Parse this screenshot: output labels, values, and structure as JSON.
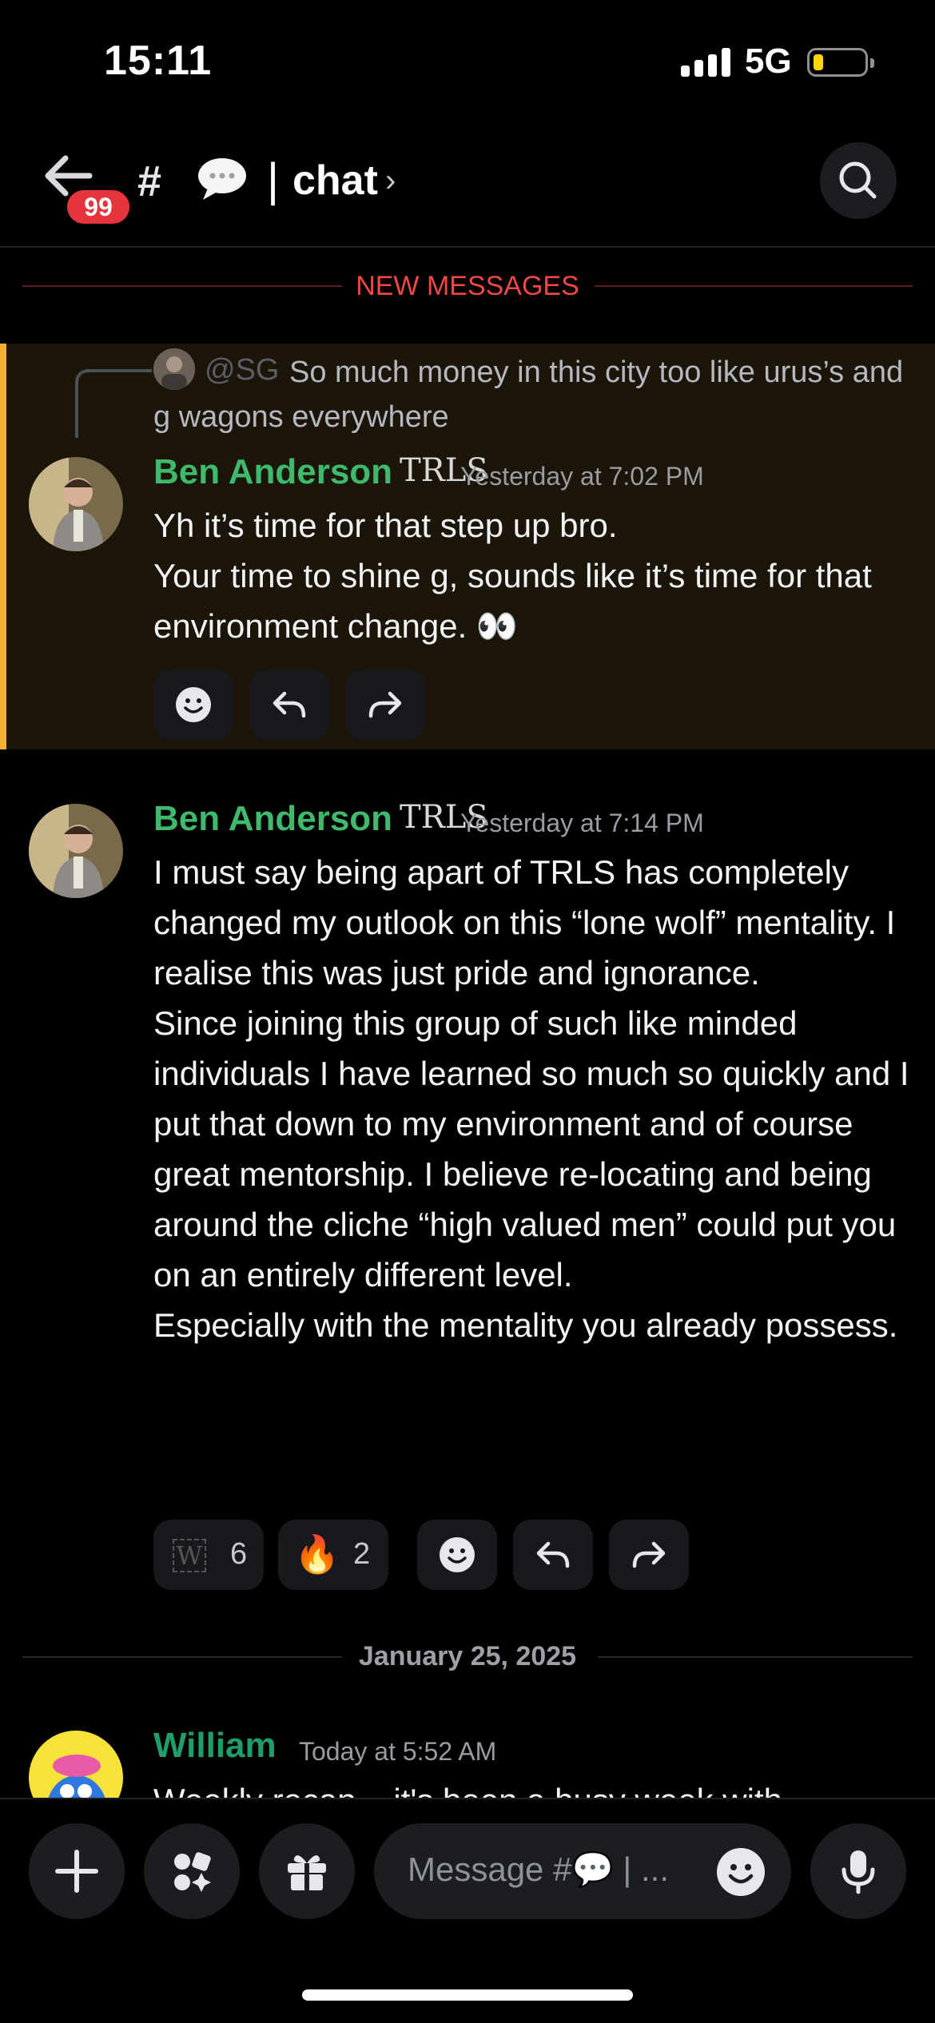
{
  "status_bar": {
    "time": "15:11",
    "network": "5G",
    "battery_color": "#ffd60a"
  },
  "header": {
    "unread_badge": "99",
    "channel_prefix": "#",
    "separator": "|",
    "channel_name": "chat",
    "chevron": "›"
  },
  "new_messages_label": "NEW MESSAGES",
  "messages": [
    {
      "reply": {
        "mention": "@SG",
        "text": "So much money in this city too like urus’s and g wagons everywhere"
      },
      "author": "Ben Anderson",
      "role_tag": "TRLS",
      "timestamp": "Yesterday at 7:02 PM",
      "lines": [
        "Yh it’s time for that step up bro.",
        "Your time to shine g, sounds like it’s time for that environment change. 👀"
      ]
    },
    {
      "author": "Ben Anderson",
      "role_tag": "TRLS",
      "timestamp": "Yesterday at 7:14 PM",
      "lines": [
        "I must say being apart of TRLS has completely changed my outlook on this “lone wolf” mentality. I realise this was just pride and ignorance.",
        "Since joining this group of such like minded individuals I have learned so much so quickly and I put that down to my environment and of course great mentorship. I believe re-locating and being around the cliche “high valued men” could put you on an entirely different level.",
        "Especially with the mentality you already possess."
      ],
      "reactions": [
        {
          "emoji": "W",
          "count": "6"
        },
        {
          "emoji": "🔥",
          "count": "2"
        }
      ]
    }
  ],
  "date_divider": "January 25, 2025",
  "next_message": {
    "author": "William",
    "timestamp": "Today at 5:52 AM",
    "preview": "Weekly recap – it's been a busy week with"
  },
  "composer": {
    "placeholder": "Message #💬 | ..."
  },
  "colors": {
    "accent_username": "#3fb96b",
    "new_messages": "#f04747",
    "highlight_border": "#f0b132",
    "highlight_bg": "#1b1609"
  },
  "icons": {
    "back": "arrow-left-icon",
    "search": "search-icon",
    "add_reaction": "smiley-icon",
    "reply": "reply-icon",
    "forward": "forward-icon",
    "plus": "plus-icon",
    "apps": "apps-icon",
    "gift": "gift-icon",
    "mic": "microphone-icon"
  }
}
